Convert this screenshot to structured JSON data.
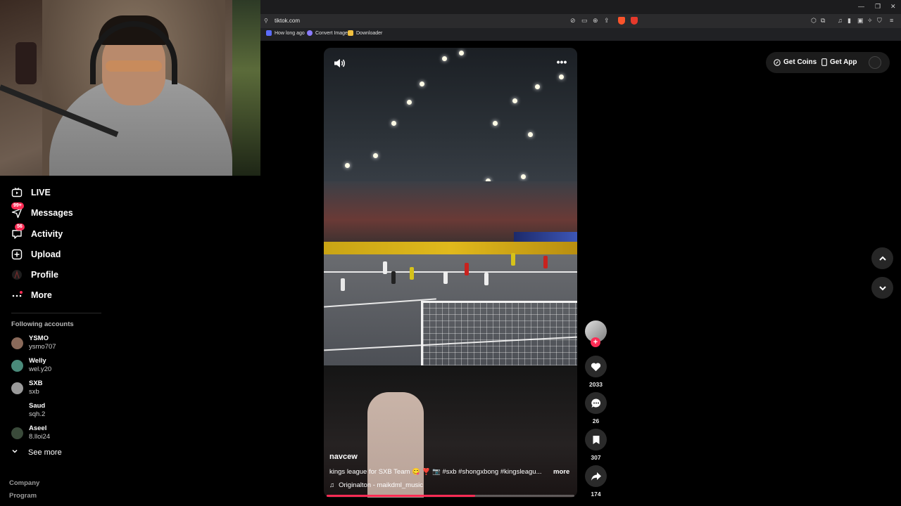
{
  "browser": {
    "url": "tiktok.com",
    "bookmarks": [
      {
        "label": "How long ago",
        "color": "#5b6cff"
      },
      {
        "label": "Convert Image",
        "color": "#8a7bff"
      },
      {
        "label": "Downloader",
        "color": "#f0c040"
      }
    ],
    "shield_badge": "8",
    "rewards_badge": "1"
  },
  "sidebar": {
    "nav": [
      {
        "label": "LIVE",
        "icon": "live-tv-icon"
      },
      {
        "label": "Messages",
        "icon": "paper-plane-icon",
        "badge": "99+"
      },
      {
        "label": "Activity",
        "icon": "chat-bubble-icon",
        "badge": "56"
      },
      {
        "label": "Upload",
        "icon": "plus-square-icon"
      },
      {
        "label": "Profile",
        "icon": "profile-avatar-icon"
      },
      {
        "label": "More",
        "icon": "ellipsis-icon"
      }
    ],
    "following_title": "Following accounts",
    "accounts": [
      {
        "name": "YSMO",
        "handle": "ysmo707"
      },
      {
        "name": "Welly",
        "handle": "wel.y20"
      },
      {
        "name": "SXB",
        "handle": "sxb"
      },
      {
        "name": "Saud",
        "handle": "sqh.2"
      },
      {
        "name": "Aseel",
        "handle": "8.lloi24"
      }
    ],
    "see_more": "See more",
    "footer": [
      "Company",
      "Program"
    ]
  },
  "video": {
    "author": "navcew",
    "caption": "kings league for SXB Team 😋 ❣️ 📷 #sxb #shongxbong #kingsleagu...",
    "caption_more": "more",
    "music": "Originalton - maikdml_music",
    "progress": 0.6,
    "likes": "2033",
    "comments": "26",
    "saves": "307",
    "shares": "174"
  },
  "topbar": {
    "get_coins": "Get Coins",
    "get_app": "Get App"
  },
  "colors": {
    "accent": "#fe2c55",
    "background": "#000000"
  }
}
